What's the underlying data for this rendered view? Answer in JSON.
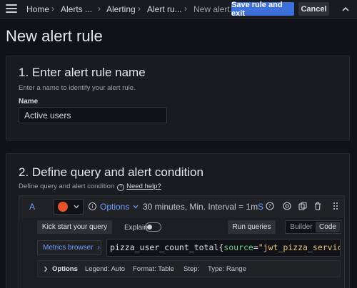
{
  "topbar": {
    "breadcrumbs": [
      "Home",
      "Alerts ...",
      "Alerting",
      "Alert ru...",
      "New alert..."
    ],
    "save_exit_label": "Save rule and exit",
    "cancel_label": "Cancel"
  },
  "page": {
    "title": "New alert rule"
  },
  "section1": {
    "heading": "1. Enter alert rule name",
    "description": "Enter a name to identify your alert rule.",
    "name_label": "Name",
    "name_value": "Active users"
  },
  "section2": {
    "heading": "2. Define query and alert condition",
    "description": "Define query and alert condition",
    "help_link": "Need help?",
    "query": {
      "ref_id": "A",
      "options_label": "Options",
      "options_summary": "30 minutes, Min. Interval = 1m",
      "truncated_text": "S",
      "kick_start_label": "Kick start your query",
      "explain_label": "Explain",
      "explain_enabled": false,
      "run_queries_label": "Run queries",
      "mode_options": [
        "Builder",
        "Code"
      ],
      "mode_selected": "Code",
      "metrics_browser_label": "Metrics browser",
      "expr": {
        "metric": "pizza_user_count_total",
        "open": "{",
        "label": "source",
        "eq": "=",
        "value": "\"jwt_pizza_service\"",
        "close": "}"
      },
      "options_row": {
        "title": "Options",
        "legend": "Legend: Auto",
        "format": "Format: Table",
        "step": "Step:",
        "type": "Type: Range"
      }
    }
  },
  "icons": {
    "menu": "hamburger-icon",
    "collapse": "chevron-up-icon",
    "datasource": "prometheus-logo",
    "info": "info-icon",
    "help": "question-circle-icon"
  },
  "colors": {
    "primary": "#3d71d9",
    "link": "#6e9fff",
    "background": "#111217",
    "panel": "#181b1f"
  }
}
